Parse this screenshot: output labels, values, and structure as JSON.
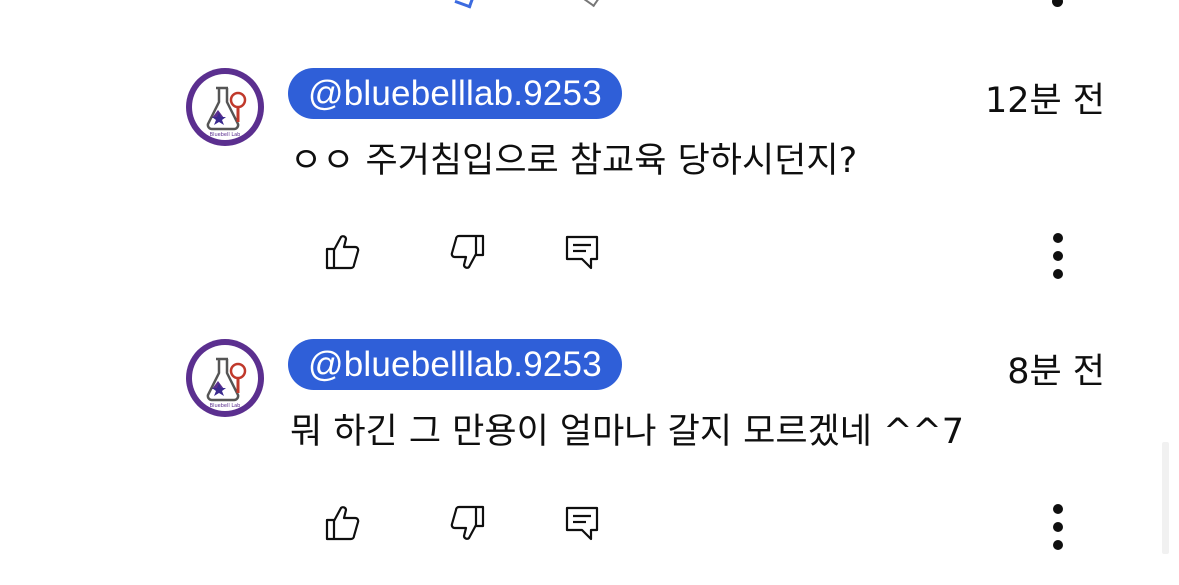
{
  "comments": [
    {
      "author": "@bluebelllab.9253",
      "timestamp": "12분 전",
      "text": "ㅇㅇ 주거침입으로 참교육 당하시던지?"
    },
    {
      "author": "@bluebelllab.9253",
      "timestamp": "8분 전",
      "text": "뭐 하긴 그 만용이 얼마나 갈지 모르겠네 ^^7"
    }
  ],
  "icons": {
    "like": "thumbs-up-icon",
    "dislike": "thumbs-down-icon",
    "reply": "comment-reply-icon",
    "menu": "more-vertical-icon"
  },
  "colors": {
    "author_chip": "#2f5fd8",
    "avatar_ring": "#5b2f8f"
  }
}
